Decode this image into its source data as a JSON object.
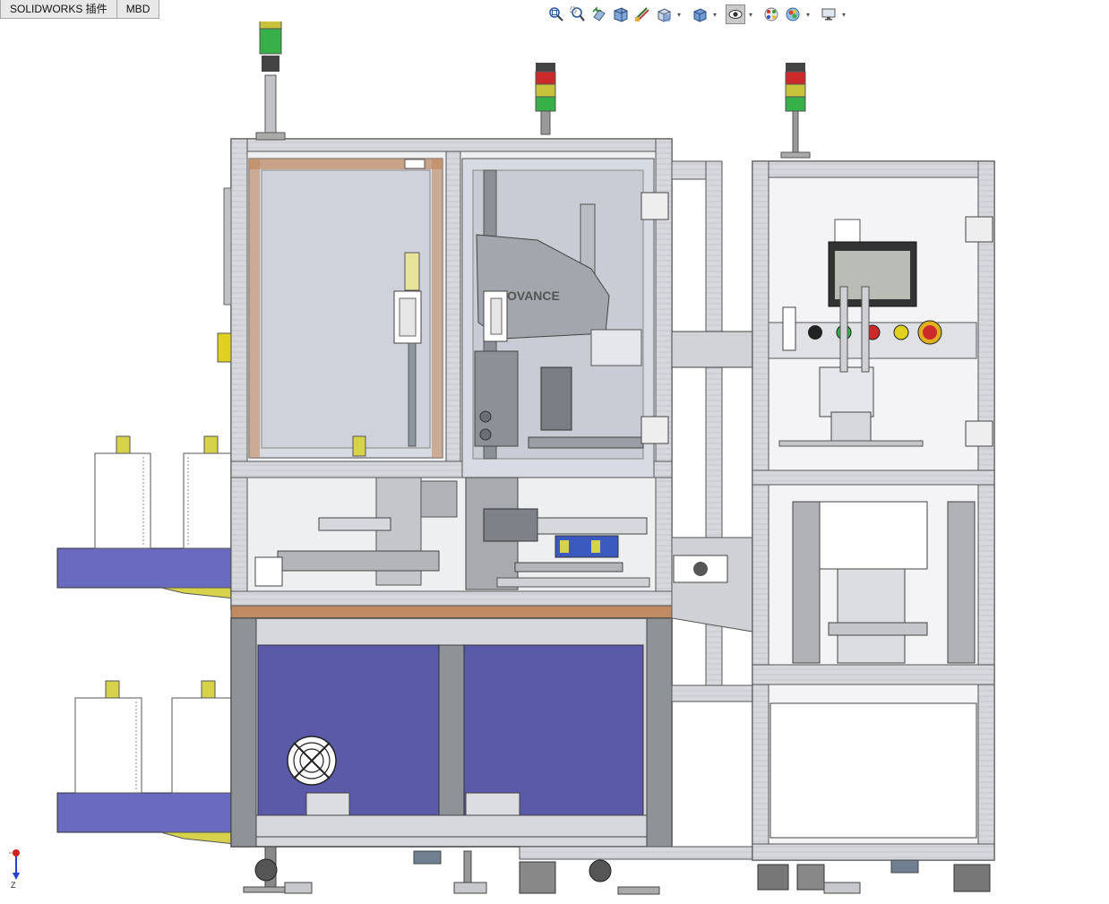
{
  "tabs": [
    {
      "label": "SOLIDWORKS 插件"
    },
    {
      "label": "MBD"
    }
  ],
  "toolbar": {
    "buttons": [
      {
        "icon": "zoom-to-fit-icon"
      },
      {
        "icon": "zoom-to-area-icon"
      },
      {
        "icon": "previous-view-icon"
      },
      {
        "icon": "section-view-icon"
      },
      {
        "icon": "dynamic-annotation-icon"
      },
      {
        "icon": "view-orientation-icon",
        "dropdown": true
      },
      {
        "icon": "display-style-icon",
        "dropdown": true
      },
      {
        "icon": "hide-show-items-icon",
        "dropdown": true,
        "active": true
      },
      {
        "icon": "edit-appearance-icon"
      },
      {
        "icon": "apply-scene-icon",
        "dropdown": true
      },
      {
        "icon": "view-settings-icon",
        "dropdown": true
      }
    ]
  },
  "model": {
    "robot_brand": "OVANCE",
    "colors": {
      "frame": "#d4d6d9",
      "frame_edge": "#555555",
      "panel_blue": "#5a5aa8",
      "conveyor_blue": "#6a6ac0",
      "glass": "#d8dbe3",
      "copper": "#c08a62",
      "yellow": "#d6d24a",
      "light_red": "#cc2a2a",
      "light_yellow": "#c8c23a",
      "light_green": "#38b04a",
      "screen": "#b9bdb5"
    }
  },
  "triad": {
    "axis_label": "Z"
  }
}
